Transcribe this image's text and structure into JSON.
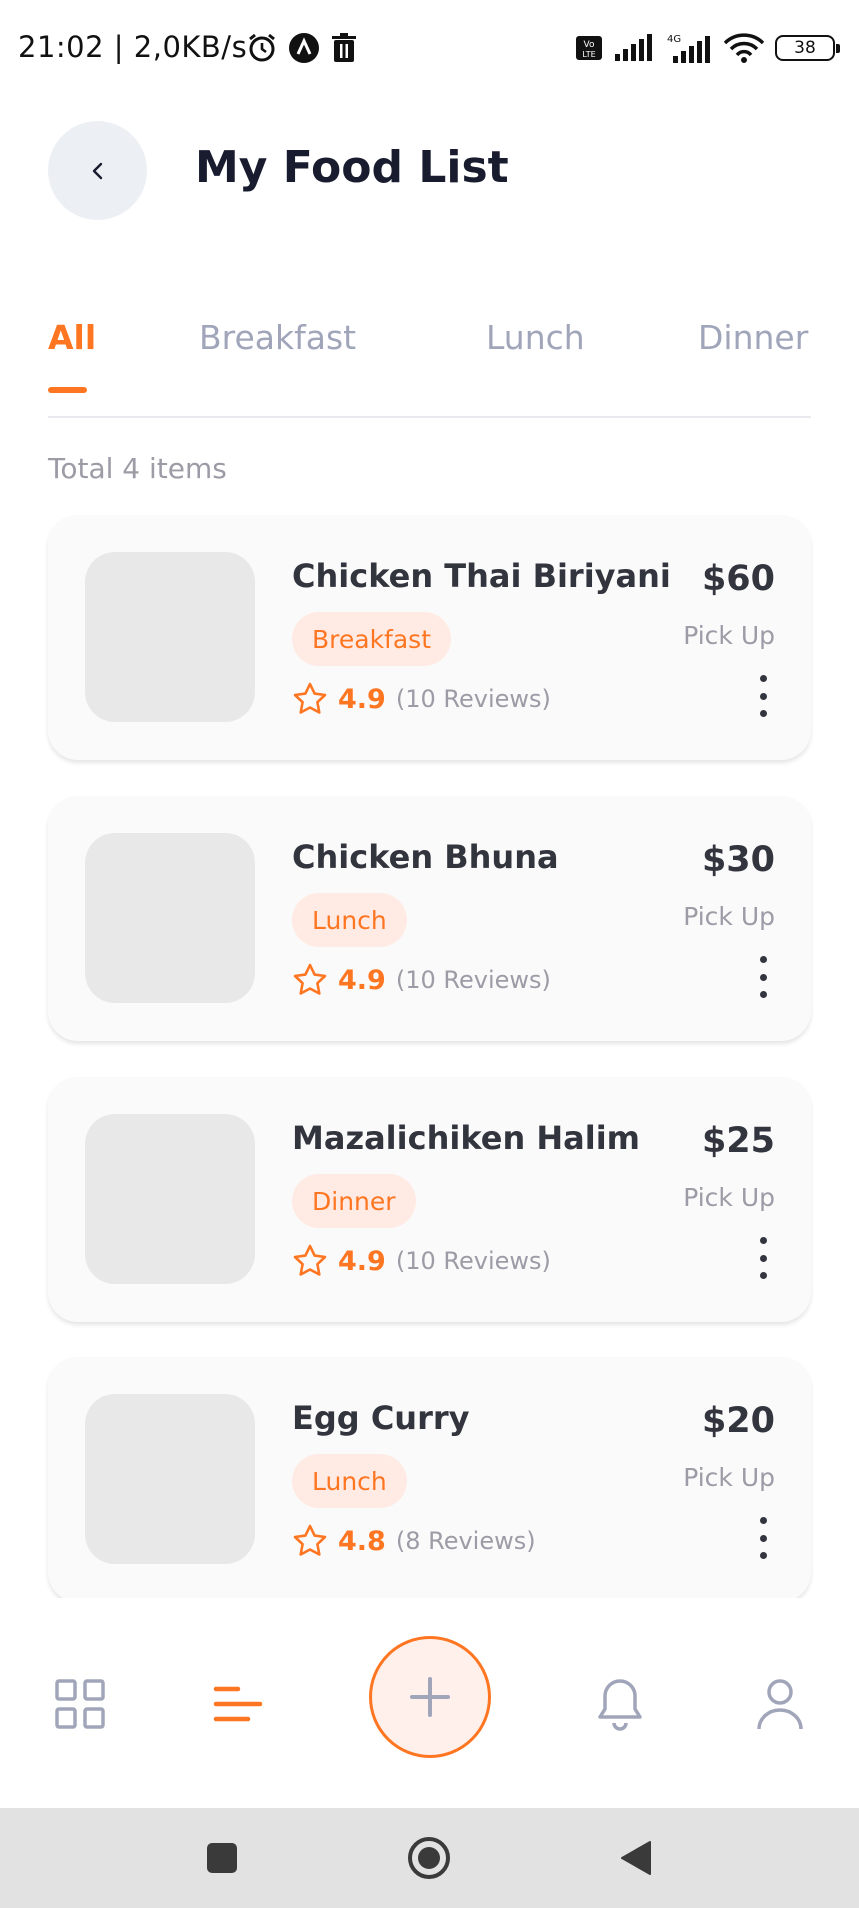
{
  "status_bar": {
    "time": "21:02 | 2,0KB/s",
    "battery": "38",
    "network": "4G"
  },
  "header": {
    "title": "My Food List"
  },
  "tabs": [
    {
      "label": "All",
      "active": true
    },
    {
      "label": "Breakfast",
      "active": false
    },
    {
      "label": "Lunch",
      "active": false
    },
    {
      "label": "Dinner",
      "active": false
    }
  ],
  "summary": {
    "total_label": "Total 4 items"
  },
  "items": [
    {
      "name": "Chicken Thai Biriyani",
      "category": "Breakfast",
      "rating": "4.9",
      "reviews": "(10 Reviews)",
      "price": "$60",
      "delivery": "Pick Up"
    },
    {
      "name": "Chicken Bhuna",
      "category": "Lunch",
      "rating": "4.9",
      "reviews": "(10 Reviews)",
      "price": "$30",
      "delivery": "Pick Up"
    },
    {
      "name": "Mazalichiken Halim",
      "category": "Dinner",
      "rating": "4.9",
      "reviews": "(10 Reviews)",
      "price": "$25",
      "delivery": "Pick Up"
    },
    {
      "name": "Egg Curry",
      "category": "Lunch",
      "rating": "4.8",
      "reviews": "(8 Reviews)",
      "price": "$20",
      "delivery": "Pick Up"
    }
  ],
  "bottom_nav": {
    "items": [
      "grid-icon",
      "list-icon",
      "plus-icon",
      "bell-icon",
      "user-icon"
    ],
    "active": "list-icon"
  },
  "colors": {
    "accent": "#ff7622",
    "tag_bg": "#ffebe4",
    "text_dark": "#32343e",
    "text_muted": "#9c9ba6",
    "card_bg": "#fafafa"
  }
}
